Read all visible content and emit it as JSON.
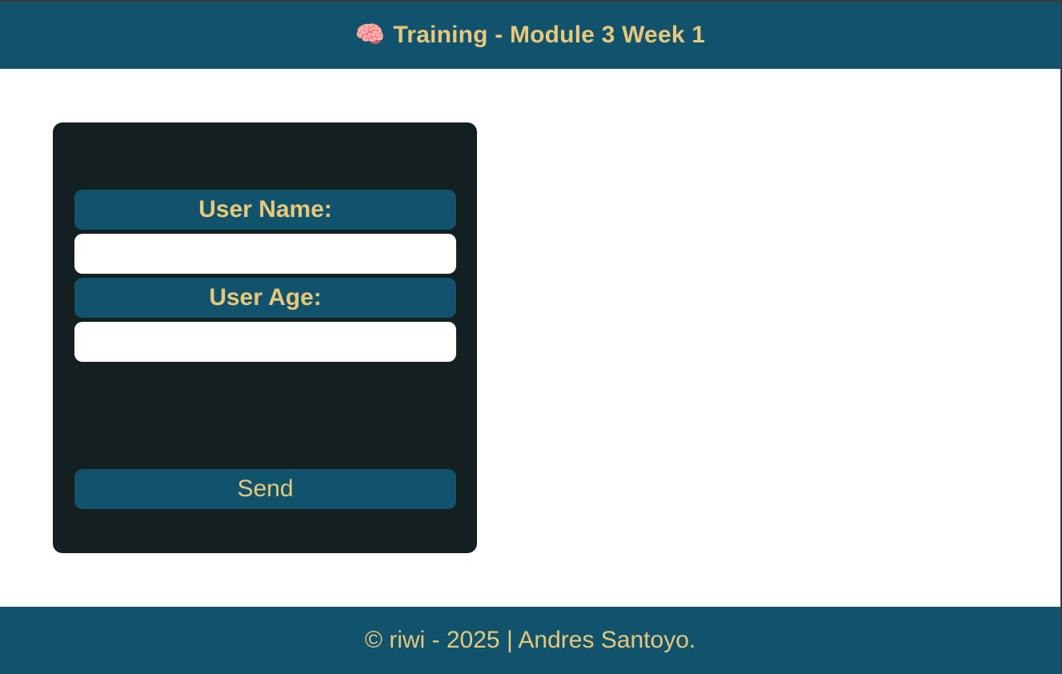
{
  "header": {
    "icon": "brain-icon",
    "icon_glyph": "🧠",
    "title": "Training - Module 3 Week 1"
  },
  "form": {
    "name_label": "User Name:",
    "name_value": "",
    "age_label": "User Age:",
    "age_value": "",
    "send_label": "Send"
  },
  "footer": {
    "text": "© riwi - 2025 | Andres Santoyo."
  },
  "colors": {
    "primary": "#11536d",
    "accent_text": "#e8c87a",
    "card_bg": "#141f21",
    "page_bg": "#ffffff"
  }
}
